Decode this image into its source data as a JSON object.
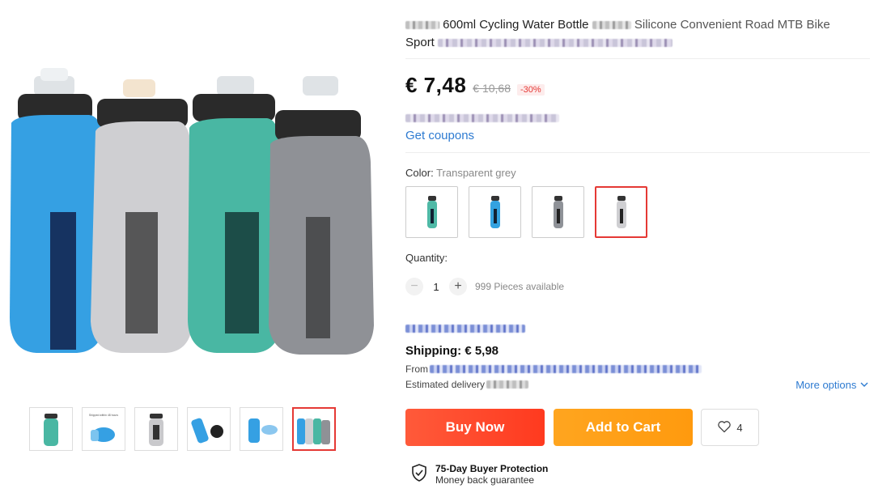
{
  "product": {
    "title_line1": "600ml Cycling Water Bottle",
    "title_line1_tail": "Silicone Convenient Road MTB Bike",
    "title_line2": "Sport"
  },
  "price": {
    "current": "€ 7,48",
    "original": "€ 10,68",
    "discount": "-30%"
  },
  "coupons": {
    "label": "Get coupons"
  },
  "color": {
    "label": "Color:",
    "selected": "Transparent grey",
    "options": [
      {
        "name": "teal",
        "hex": "#4fb9a6"
      },
      {
        "name": "blue",
        "hex": "#34a2e0"
      },
      {
        "name": "grey",
        "hex": "#8f9298"
      },
      {
        "name": "transparent grey",
        "hex": "#cfcfd2"
      }
    ]
  },
  "quantity": {
    "label": "Quantity:",
    "value": "1",
    "minus": "−",
    "plus": "+",
    "available": "999 Pieces available"
  },
  "shipping": {
    "label": "Shipping: € 5,98",
    "from_prefix": "From",
    "delivery_prefix": "Estimated delivery",
    "more_options": "More options"
  },
  "actions": {
    "buy_now": "Buy Now",
    "add_to_cart": "Add to Cart",
    "wishlist_count": "4"
  },
  "protection": {
    "title": "75-Day Buyer Protection",
    "subtitle": "Money back guarantee"
  },
  "gallery": {
    "bottle_colors": [
      "#35a0e3",
      "#cfcfd2",
      "#49b7a3",
      "#8f9196"
    ],
    "thumb_texts": [
      "Shipped within 48 hours"
    ],
    "active_thumb": 6
  },
  "colors": {
    "accent_red": "#e53935",
    "link_blue": "#2e7bd1",
    "buy_now": "#ff4a2a",
    "add_to_cart": "#ffa11a"
  }
}
